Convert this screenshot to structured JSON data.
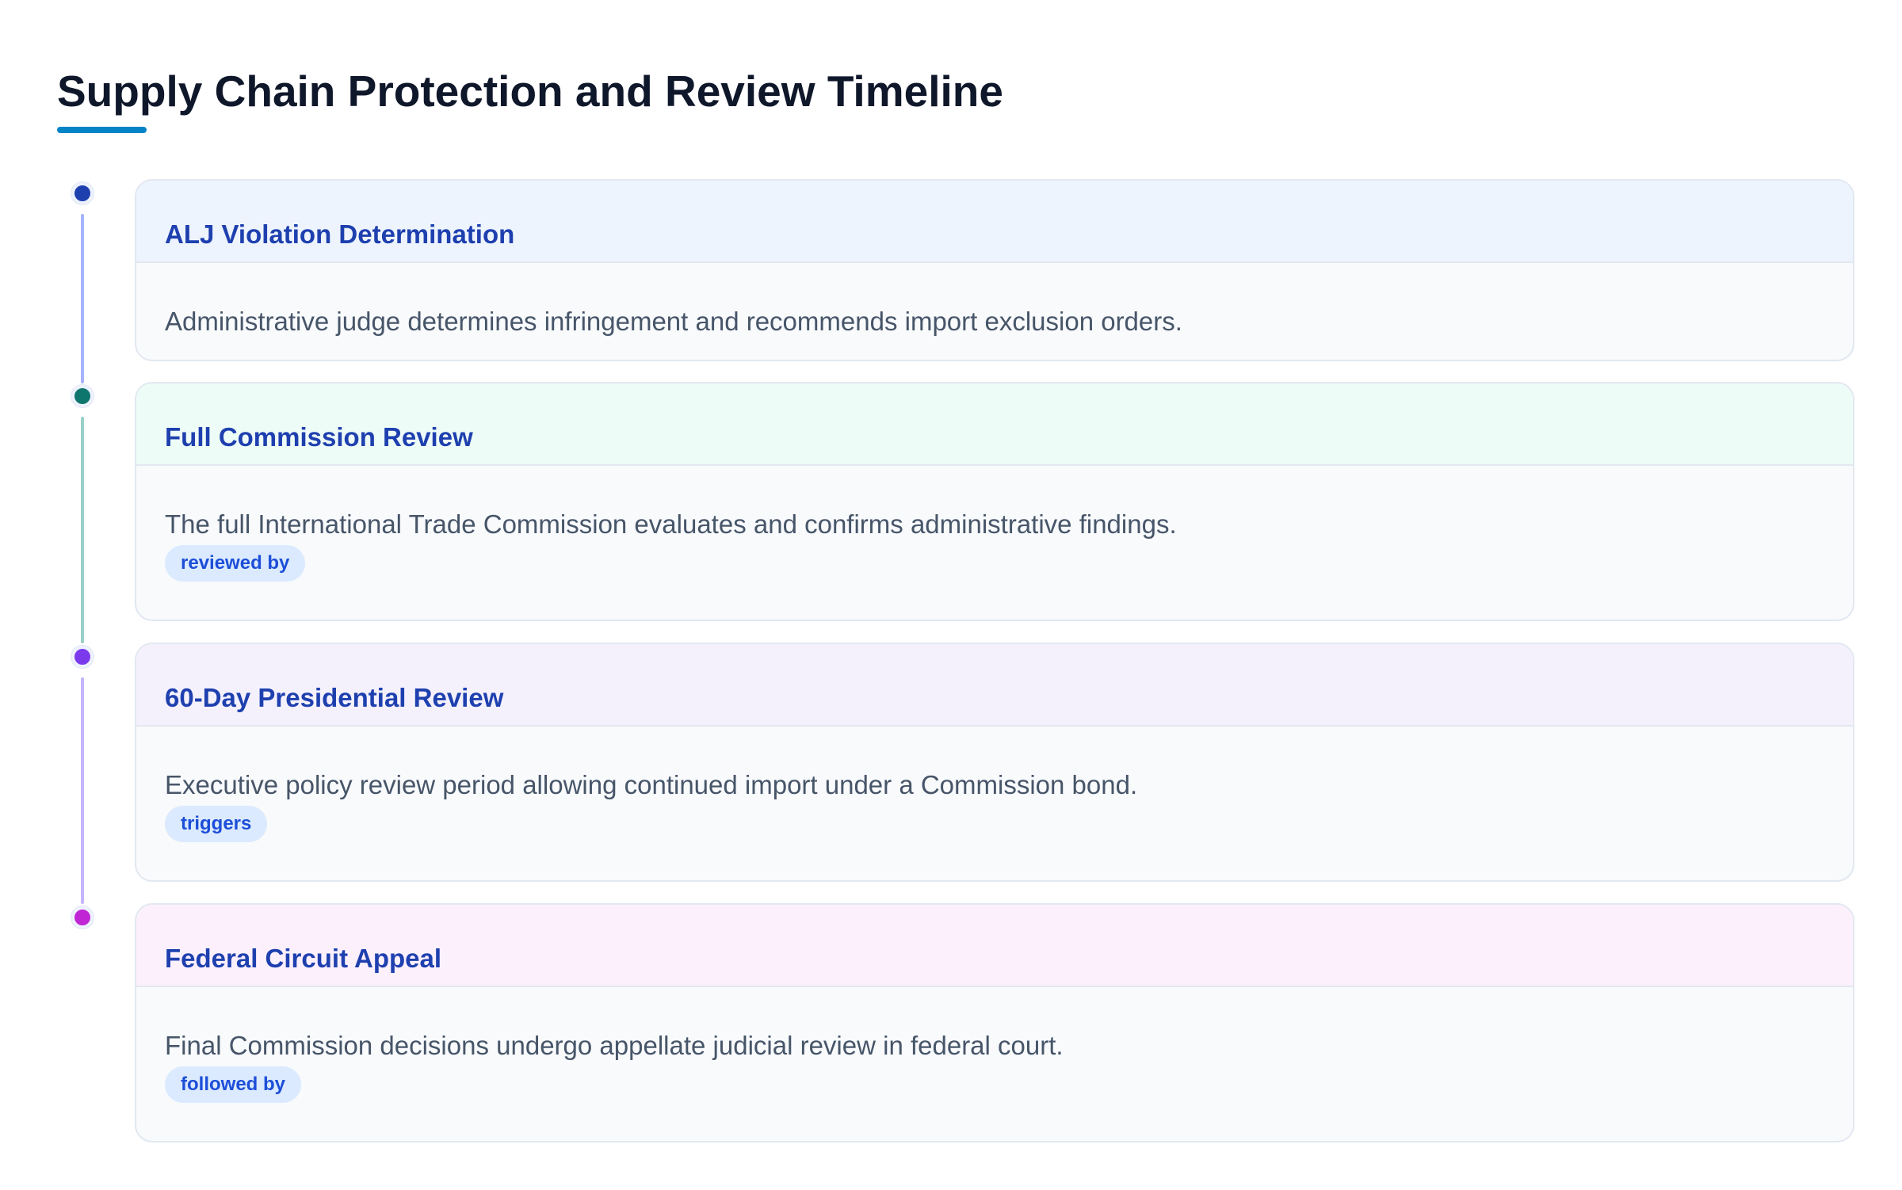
{
  "title": "Supply Chain Protection and Review Timeline",
  "colors": {
    "title": "#0f172a",
    "title_underline": "#0284c7",
    "card_title": "#1e40af",
    "description": "#475569",
    "badge_background": "#dbeafe",
    "badge_text": "#1d4ed8"
  },
  "events": [
    {
      "title": "ALJ Violation Determination",
      "description": "Administrative judge determines infringement and recommends import exclusion orders.",
      "relation": "",
      "marker_color": "#1e40af",
      "header_color": "#eef4fe",
      "connector_color": "#a5b4fc"
    },
    {
      "title": "Full Commission Review",
      "description": "The full International Trade Commission evaluates and confirms administrative findings.",
      "relation": "reviewed by",
      "marker_color": "#0f766e",
      "header_color": "#eefcf8",
      "connector_color": "#99cfc7"
    },
    {
      "title": "60-Day Presidential Review",
      "description": "Executive policy review period allowing continued import under a Commission bond.",
      "relation": "triggers",
      "marker_color": "#7c3aed",
      "header_color": "#f4f1fd",
      "connector_color": "#c4b5fd"
    },
    {
      "title": "Federal Circuit Appeal",
      "description": "Final Commission decisions undergo appellate judicial review in federal court.",
      "relation": "followed by",
      "marker_color": "#c026d3",
      "header_color": "#fdf0fd",
      "connector_color": ""
    }
  ]
}
